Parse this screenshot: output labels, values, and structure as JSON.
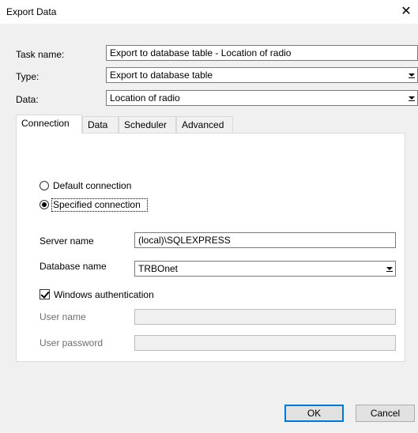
{
  "window": {
    "title": "Export Data",
    "close_glyph": "✕"
  },
  "form": {
    "task_name_label": "Task name:",
    "task_name_value": "Export to database table - Location of radio",
    "type_label": "Type:",
    "type_value": "Export to database table",
    "data_label": "Data:",
    "data_value": "Location of radio"
  },
  "tabs": [
    {
      "label": "Connection",
      "active": true
    },
    {
      "label": "Data",
      "active": false
    },
    {
      "label": "Scheduler",
      "active": false
    },
    {
      "label": "Advanced",
      "active": false
    }
  ],
  "connection": {
    "default_connection_label": "Default connection",
    "specified_connection_label": "Specified connection",
    "selected": "specified",
    "server_name_label": "Server name",
    "server_name_value": "(local)\\SQLEXPRESS",
    "database_name_label": "Database name",
    "database_name_value": "TRBOnet",
    "windows_auth_label": "Windows authentication",
    "windows_auth_checked": true,
    "user_name_label": "User name",
    "user_name_value": "",
    "user_password_label": "User password",
    "user_password_value": ""
  },
  "buttons": {
    "ok_label": "OK",
    "cancel_label": "Cancel"
  },
  "icons": {
    "close": "close-icon",
    "dropdown": "chevron-down-icon"
  }
}
